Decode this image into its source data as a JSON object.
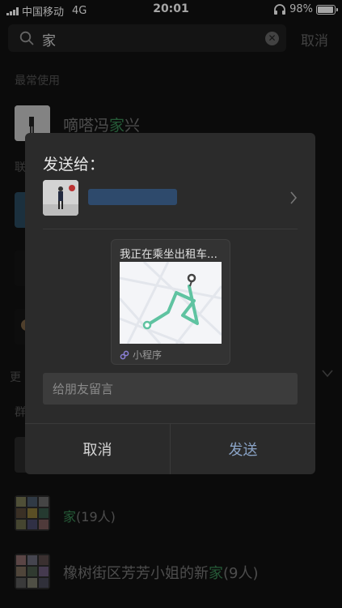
{
  "status": {
    "carrier": "中国移动",
    "network": "4G",
    "time": "20:01",
    "battery": "98%",
    "battery_level": 0.98
  },
  "search": {
    "query": "家",
    "cancel_label": "取消"
  },
  "background": {
    "section_frequent": "最常使用",
    "frequent_item": {
      "name_prefix": "嘀嗒冯",
      "name_highlight": "家",
      "name_suffix": "兴"
    },
    "section_contacts_partial": "联",
    "section_more_partial": "更",
    "section_groups_partial": "群",
    "groups": [
      {
        "highlight": "家",
        "suffix": "(19人)"
      },
      {
        "prefix": "橡树街区芳芳小姐的新",
        "highlight": "家",
        "suffix": "(9人)"
      }
    ]
  },
  "dialog": {
    "title": "发送给：",
    "card_title": "我正在乘坐出租车...",
    "card_source": "小程序",
    "message_placeholder": "给朋友留言",
    "cancel_label": "取消",
    "send_label": "发送"
  },
  "colors": {
    "highlight": "#3a8a55",
    "send": "#8aa3c6",
    "route": "#5fc3a1"
  }
}
